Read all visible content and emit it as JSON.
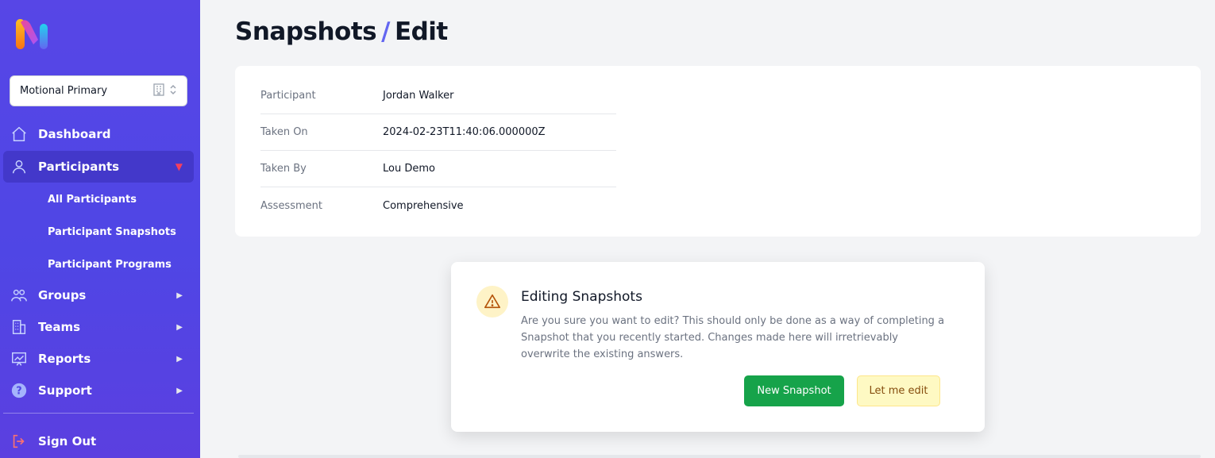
{
  "workspace": {
    "label": "Motional Primary"
  },
  "nav": {
    "dashboard": "Dashboard",
    "participants": "Participants",
    "sub": [
      "All Participants",
      "Participant Snapshots",
      "Participant Programs"
    ],
    "groups": "Groups",
    "teams": "Teams",
    "reports": "Reports",
    "support": "Support",
    "signout": "Sign Out"
  },
  "header": {
    "section": "Snapshots",
    "separator": "/",
    "page": "Edit"
  },
  "details": [
    {
      "key": "Participant",
      "value": "Jordan Walker"
    },
    {
      "key": "Taken On",
      "value": "2024-02-23T11:40:06.000000Z"
    },
    {
      "key": "Taken By",
      "value": "Lou Demo"
    },
    {
      "key": "Assessment",
      "value": "Comprehensive"
    }
  ],
  "modal": {
    "title": "Editing Snapshots",
    "text": "Are you sure you want to edit? This should only be done as a way of completing a Snapshot that you recently started. Changes made here will irretrievably overwrite the existing answers.",
    "primary_label": "New Snapshot",
    "secondary_label": "Let me edit"
  },
  "colors": {
    "sidebar": "#4f46e5",
    "active": "#4338ca",
    "primary_button": "#16a34a",
    "warning": "#fef3c7",
    "signout_icon": "#f87171"
  }
}
